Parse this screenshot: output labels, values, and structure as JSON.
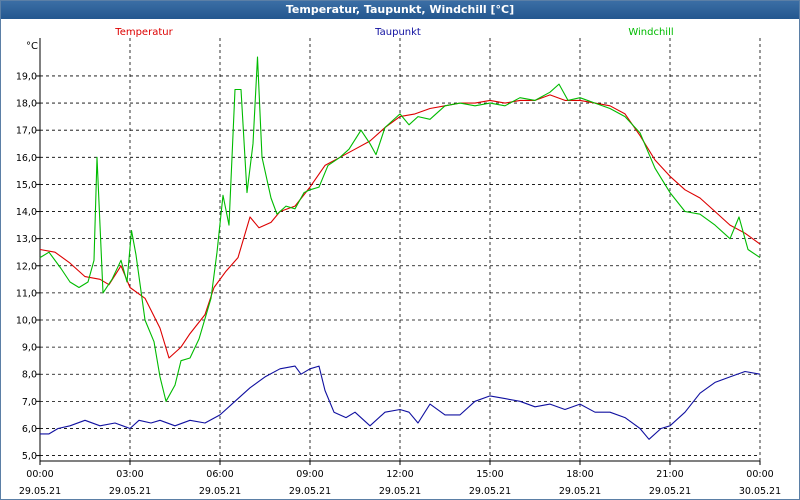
{
  "window": {
    "title": "Temperatur, Taupunkt, Windchill [°C]"
  },
  "chart_data": {
    "type": "line",
    "title": "Temperatur, Taupunkt, Windchill [°C]",
    "ylabel": "°C",
    "ylim": [
      4.8,
      20.4
    ],
    "yticks": [
      5,
      6,
      7,
      8,
      9,
      10,
      11,
      12,
      13,
      14,
      15,
      16,
      17,
      18,
      19
    ],
    "ytick_labels": [
      "5,0",
      "6,0",
      "7,0",
      "8,0",
      "9,0",
      "10,0",
      "11,0",
      "12,0",
      "13,0",
      "14,0",
      "15,0",
      "16,0",
      "17,0",
      "18,0",
      "19,0"
    ],
    "xlim": [
      0,
      24
    ],
    "xticks": [
      0,
      3,
      6,
      9,
      12,
      15,
      18,
      21,
      24
    ],
    "xtick_labels": [
      {
        "time": "00:00",
        "date": "29.05.21"
      },
      {
        "time": "03:00",
        "date": "29.05.21"
      },
      {
        "time": "06:00",
        "date": "29.05.21"
      },
      {
        "time": "09:00",
        "date": "29.05.21"
      },
      {
        "time": "12:00",
        "date": "29.05.21"
      },
      {
        "time": "15:00",
        "date": "29.05.21"
      },
      {
        "time": "18:00",
        "date": "29.05.21"
      },
      {
        "time": "21:00",
        "date": "29.05.21"
      },
      {
        "time": "00:00",
        "date": "30.05.21"
      }
    ],
    "grid": true,
    "legend_position": "top",
    "series": [
      {
        "name": "Temperatur",
        "color": "#dd0000",
        "points": [
          [
            0,
            12.6
          ],
          [
            0.5,
            12.5
          ],
          [
            1,
            12.1
          ],
          [
            1.5,
            11.6
          ],
          [
            2,
            11.5
          ],
          [
            2.3,
            11.3
          ],
          [
            2.7,
            12.0
          ],
          [
            3,
            11.2
          ],
          [
            3.5,
            10.8
          ],
          [
            4,
            9.7
          ],
          [
            4.3,
            8.6
          ],
          [
            4.7,
            9.0
          ],
          [
            5,
            9.5
          ],
          [
            5.5,
            10.2
          ],
          [
            5.8,
            11.2
          ],
          [
            6.2,
            11.8
          ],
          [
            6.6,
            12.3
          ],
          [
            7,
            13.8
          ],
          [
            7.3,
            13.4
          ],
          [
            7.7,
            13.6
          ],
          [
            8,
            14.0
          ],
          [
            8.5,
            14.2
          ],
          [
            9,
            14.9
          ],
          [
            9.5,
            15.7
          ],
          [
            10,
            16.0
          ],
          [
            10.5,
            16.3
          ],
          [
            11,
            16.6
          ],
          [
            11.5,
            17.1
          ],
          [
            12,
            17.5
          ],
          [
            12.5,
            17.6
          ],
          [
            13,
            17.8
          ],
          [
            13.5,
            17.9
          ],
          [
            14,
            18.0
          ],
          [
            14.5,
            18.0
          ],
          [
            15,
            18.1
          ],
          [
            15.5,
            18.0
          ],
          [
            16,
            18.1
          ],
          [
            16.5,
            18.1
          ],
          [
            17,
            18.3
          ],
          [
            17.5,
            18.1
          ],
          [
            18,
            18.1
          ],
          [
            18.5,
            18.0
          ],
          [
            19,
            17.9
          ],
          [
            19.5,
            17.6
          ],
          [
            20,
            16.8
          ],
          [
            20.5,
            15.9
          ],
          [
            21,
            15.3
          ],
          [
            21.5,
            14.8
          ],
          [
            22,
            14.5
          ],
          [
            22.5,
            14.0
          ],
          [
            23,
            13.5
          ],
          [
            23.5,
            13.2
          ],
          [
            24,
            12.8
          ]
        ]
      },
      {
        "name": "Taupunkt",
        "color": "#1010a0",
        "points": [
          [
            0,
            5.8
          ],
          [
            0.3,
            5.8
          ],
          [
            0.6,
            6.0
          ],
          [
            1,
            6.1
          ],
          [
            1.5,
            6.3
          ],
          [
            2,
            6.1
          ],
          [
            2.5,
            6.2
          ],
          [
            3,
            6.0
          ],
          [
            3.3,
            6.3
          ],
          [
            3.7,
            6.2
          ],
          [
            4,
            6.3
          ],
          [
            4.5,
            6.1
          ],
          [
            5,
            6.3
          ],
          [
            5.5,
            6.2
          ],
          [
            6,
            6.5
          ],
          [
            6.5,
            7.0
          ],
          [
            7,
            7.5
          ],
          [
            7.5,
            7.9
          ],
          [
            8,
            8.2
          ],
          [
            8.5,
            8.3
          ],
          [
            8.7,
            8.0
          ],
          [
            9,
            8.2
          ],
          [
            9.3,
            8.3
          ],
          [
            9.5,
            7.4
          ],
          [
            9.8,
            6.6
          ],
          [
            10.2,
            6.4
          ],
          [
            10.5,
            6.6
          ],
          [
            11,
            6.1
          ],
          [
            11.5,
            6.6
          ],
          [
            12,
            6.7
          ],
          [
            12.3,
            6.6
          ],
          [
            12.6,
            6.2
          ],
          [
            13,
            6.9
          ],
          [
            13.5,
            6.5
          ],
          [
            14,
            6.5
          ],
          [
            14.5,
            7.0
          ],
          [
            15,
            7.2
          ],
          [
            15.5,
            7.1
          ],
          [
            16,
            7.0
          ],
          [
            16.5,
            6.8
          ],
          [
            17,
            6.9
          ],
          [
            17.5,
            6.7
          ],
          [
            18,
            6.9
          ],
          [
            18.5,
            6.6
          ],
          [
            19,
            6.6
          ],
          [
            19.5,
            6.4
          ],
          [
            20,
            6.0
          ],
          [
            20.3,
            5.6
          ],
          [
            20.7,
            6.0
          ],
          [
            21,
            6.1
          ],
          [
            21.5,
            6.6
          ],
          [
            22,
            7.3
          ],
          [
            22.5,
            7.7
          ],
          [
            23,
            7.9
          ],
          [
            23.5,
            8.1
          ],
          [
            24,
            8.0
          ]
        ]
      },
      {
        "name": "Windchill",
        "color": "#00bb00",
        "points": [
          [
            0,
            12.3
          ],
          [
            0.3,
            12.5
          ],
          [
            0.7,
            11.9
          ],
          [
            1,
            11.4
          ],
          [
            1.3,
            11.2
          ],
          [
            1.6,
            11.4
          ],
          [
            1.8,
            12.2
          ],
          [
            1.9,
            16.0
          ],
          [
            2.1,
            11.0
          ],
          [
            2.4,
            11.5
          ],
          [
            2.7,
            12.2
          ],
          [
            2.9,
            11.4
          ],
          [
            3.05,
            13.3
          ],
          [
            3.2,
            12.4
          ],
          [
            3.5,
            10.0
          ],
          [
            3.8,
            9.2
          ],
          [
            4,
            7.9
          ],
          [
            4.2,
            7.0
          ],
          [
            4.5,
            7.6
          ],
          [
            4.7,
            8.5
          ],
          [
            5,
            8.6
          ],
          [
            5.3,
            9.3
          ],
          [
            5.7,
            10.8
          ],
          [
            5.9,
            12.5
          ],
          [
            6.1,
            14.6
          ],
          [
            6.3,
            13.5
          ],
          [
            6.5,
            18.5
          ],
          [
            6.7,
            18.5
          ],
          [
            6.9,
            14.7
          ],
          [
            7.1,
            16.5
          ],
          [
            7.25,
            19.7
          ],
          [
            7.4,
            16.0
          ],
          [
            7.7,
            14.5
          ],
          [
            7.9,
            13.9
          ],
          [
            8.2,
            14.2
          ],
          [
            8.5,
            14.1
          ],
          [
            8.8,
            14.7
          ],
          [
            9,
            14.8
          ],
          [
            9.3,
            14.9
          ],
          [
            9.6,
            15.7
          ],
          [
            10,
            16.0
          ],
          [
            10.3,
            16.3
          ],
          [
            10.7,
            17.0
          ],
          [
            11,
            16.5
          ],
          [
            11.2,
            16.1
          ],
          [
            11.5,
            17.1
          ],
          [
            12,
            17.6
          ],
          [
            12.3,
            17.2
          ],
          [
            12.6,
            17.5
          ],
          [
            13,
            17.4
          ],
          [
            13.5,
            17.9
          ],
          [
            14,
            18.0
          ],
          [
            14.5,
            17.9
          ],
          [
            15,
            18.0
          ],
          [
            15.5,
            17.9
          ],
          [
            16,
            18.2
          ],
          [
            16.5,
            18.1
          ],
          [
            17,
            18.4
          ],
          [
            17.3,
            18.7
          ],
          [
            17.6,
            18.1
          ],
          [
            18,
            18.2
          ],
          [
            18.5,
            18.0
          ],
          [
            19,
            17.8
          ],
          [
            19.5,
            17.5
          ],
          [
            20,
            16.9
          ],
          [
            20.5,
            15.6
          ],
          [
            21,
            14.7
          ],
          [
            21.5,
            14.0
          ],
          [
            22,
            13.9
          ],
          [
            22.5,
            13.5
          ],
          [
            23,
            13.0
          ],
          [
            23.3,
            13.8
          ],
          [
            23.6,
            12.6
          ],
          [
            24,
            12.3
          ]
        ]
      }
    ]
  }
}
